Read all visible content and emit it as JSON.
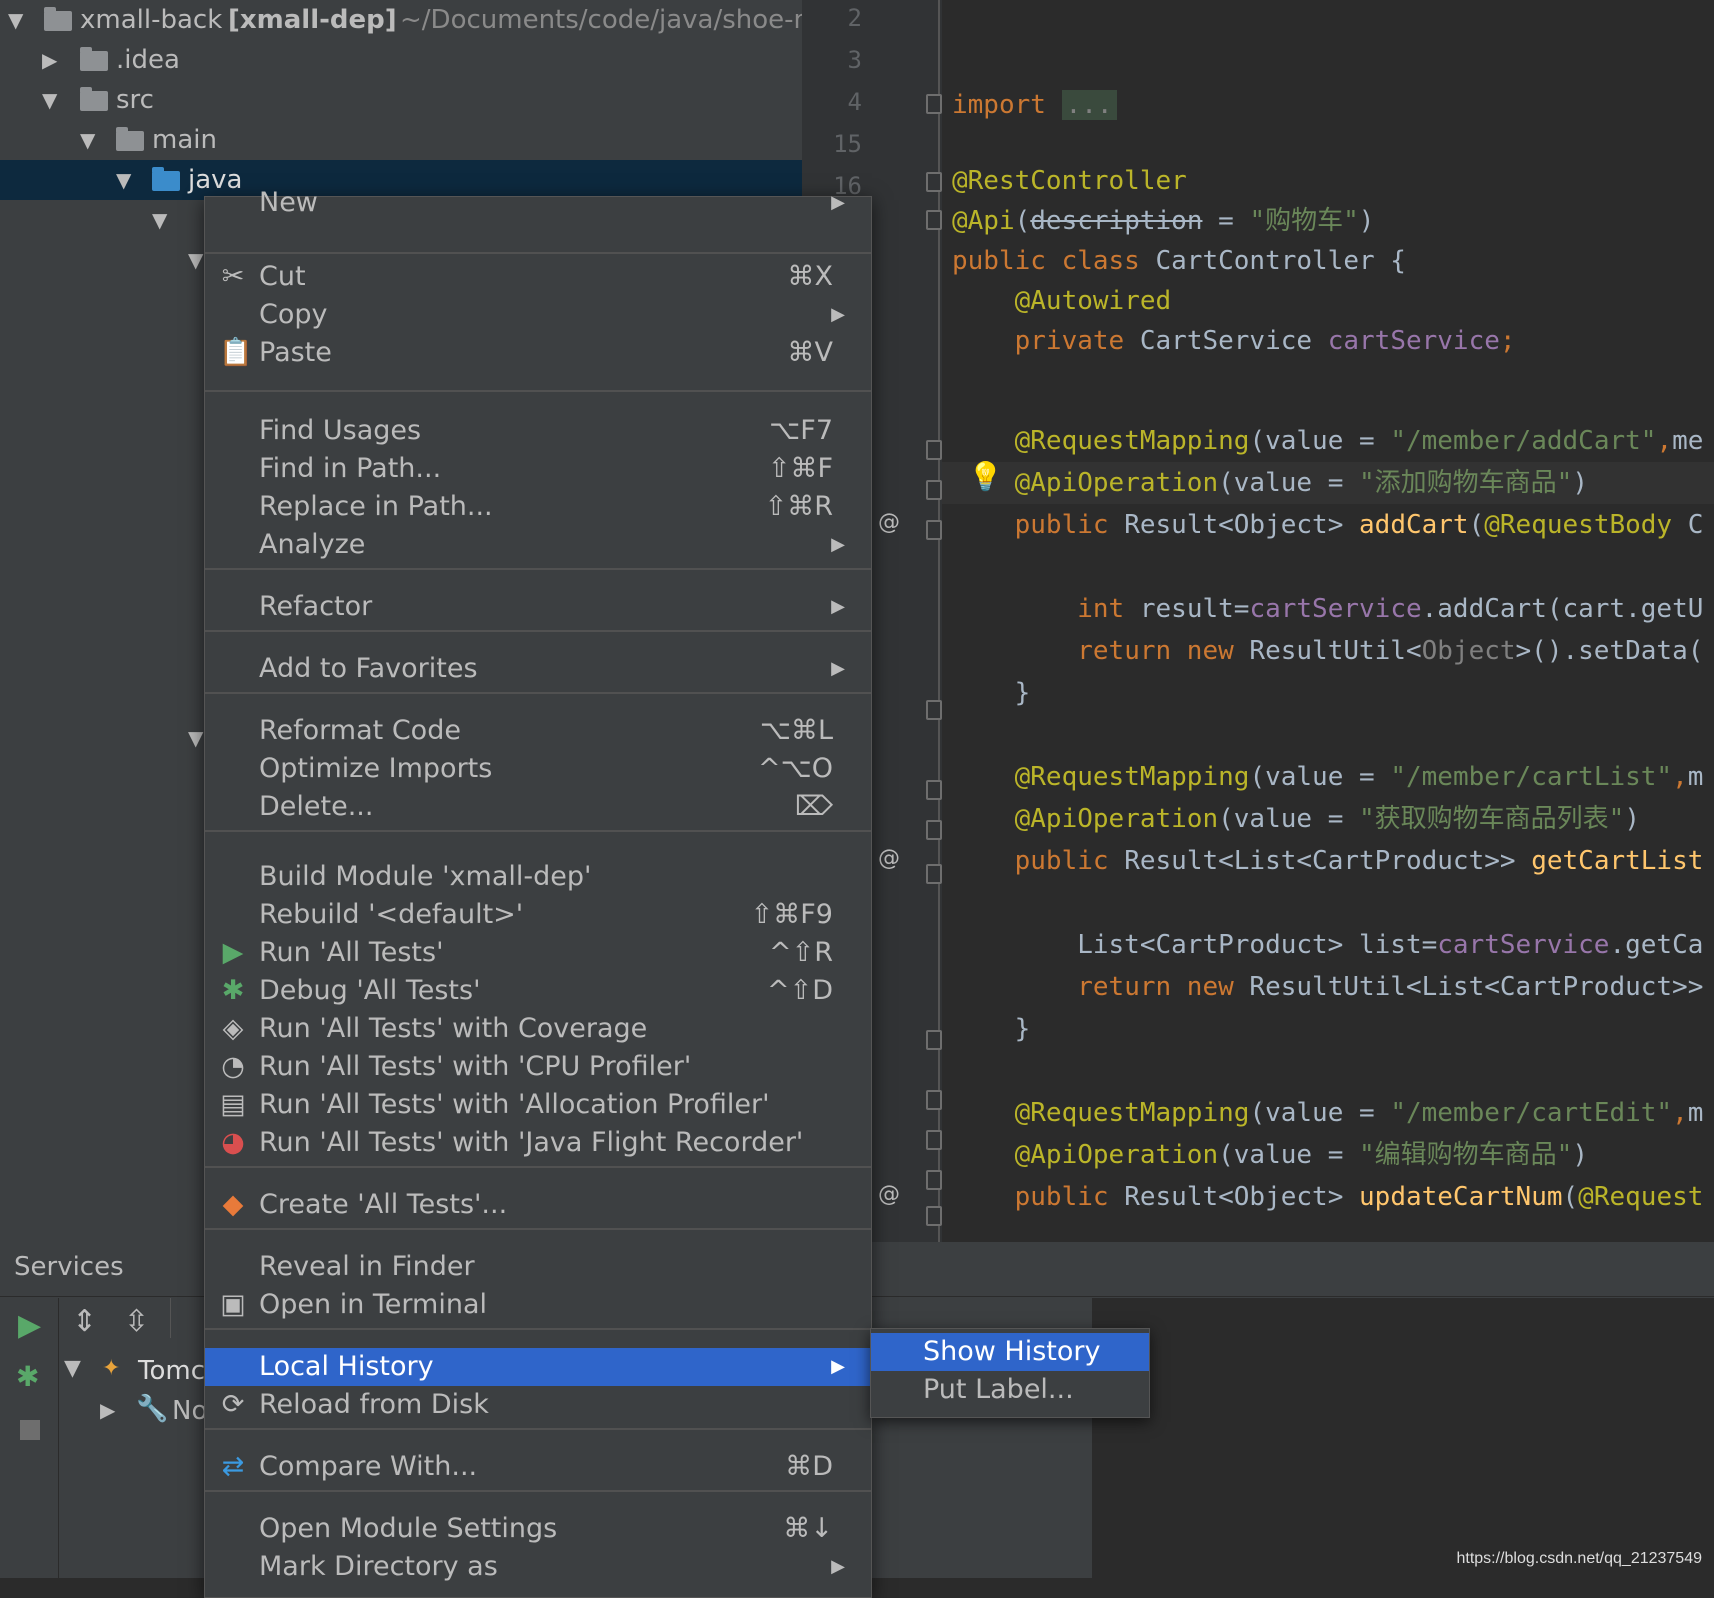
{
  "tree": {
    "root": {
      "name": "xmall-back",
      "module": "[xmall-dep]",
      "path": "~/Documents/code/java/shoe-m"
    },
    "items": [
      ".idea",
      "src",
      "main",
      "java"
    ]
  },
  "gutter": {
    "line_numbers": [
      "2",
      "3",
      "4",
      "15",
      "16"
    ]
  },
  "editor": {
    "lines": [
      {
        "parts": [
          [
            "kw",
            "import "
          ],
          [
            "gr",
            "..."
          ]
        ]
      },
      {
        "parts": [
          [
            "an",
            "@RestController"
          ]
        ]
      },
      {
        "parts": [
          [
            "an",
            "@Api"
          ],
          [
            "",
            "("
          ],
          [
            "",
            "description"
          ],
          [
            "",
            " = "
          ],
          [
            "st",
            "\"购物车\""
          ],
          [
            "",
            ")"
          ]
        ]
      },
      {
        "parts": [
          [
            "kw",
            "public class "
          ],
          [
            "",
            "CartController {"
          ]
        ]
      },
      {
        "parts": [
          [
            "",
            "    "
          ],
          [
            "an",
            "@Autowired"
          ]
        ]
      },
      {
        "parts": [
          [
            "",
            "    "
          ],
          [
            "kw",
            "private "
          ],
          [
            "",
            "CartService "
          ],
          [
            "fd",
            "cartService"
          ],
          [
            "kw",
            ";"
          ]
        ]
      },
      {
        "parts": []
      },
      {
        "parts": [
          [
            "",
            "    "
          ],
          [
            "an",
            "@RequestMapping"
          ],
          [
            "",
            "(value = "
          ],
          [
            "st",
            "\"/member/addCart\""
          ],
          [
            "kw",
            ","
          ],
          [
            "",
            "me"
          ]
        ]
      },
      {
        "parts": [
          [
            "",
            "    "
          ],
          [
            "an",
            "@ApiOperation"
          ],
          [
            "",
            "(value = "
          ],
          [
            "st",
            "\"添加购物车商品\""
          ],
          [
            "",
            ")"
          ]
        ]
      },
      {
        "parts": [
          [
            "",
            "    "
          ],
          [
            "kw",
            "public "
          ],
          [
            "",
            "Result<Object> "
          ],
          [
            "fn",
            "addCart"
          ],
          [
            "",
            "("
          ],
          [
            "an",
            "@RequestBody"
          ],
          [
            "",
            " C"
          ]
        ]
      },
      {
        "parts": []
      },
      {
        "parts": [
          [
            "",
            "        "
          ],
          [
            "kw",
            "int "
          ],
          [
            "",
            "result="
          ],
          [
            "fd",
            "cartService"
          ],
          [
            "",
            ".addCart(cart.getU"
          ]
        ]
      },
      {
        "parts": [
          [
            "",
            "        "
          ],
          [
            "kw",
            "return new "
          ],
          [
            "",
            "ResultUtil<"
          ],
          [
            "gr",
            "Object"
          ],
          [
            "",
            ">().setData("
          ]
        ]
      },
      {
        "parts": [
          [
            "",
            "    }"
          ]
        ]
      },
      {
        "parts": []
      },
      {
        "parts": [
          [
            "",
            "    "
          ],
          [
            "an",
            "@RequestMapping"
          ],
          [
            "",
            "(value = "
          ],
          [
            "st",
            "\"/member/cartList\""
          ],
          [
            "kw",
            ","
          ],
          [
            "",
            "m"
          ]
        ]
      },
      {
        "parts": [
          [
            "",
            "    "
          ],
          [
            "an",
            "@ApiOperation"
          ],
          [
            "",
            "(value = "
          ],
          [
            "st",
            "\"获取购物车商品列表\""
          ],
          [
            "",
            ")"
          ]
        ]
      },
      {
        "parts": [
          [
            "",
            "    "
          ],
          [
            "kw",
            "public "
          ],
          [
            "",
            "Result<List<CartProduct>> "
          ],
          [
            "fn",
            "getCartList"
          ]
        ]
      },
      {
        "parts": []
      },
      {
        "parts": [
          [
            "",
            "        List<CartProduct> list="
          ],
          [
            "fd",
            "cartService"
          ],
          [
            "",
            ".getCa"
          ]
        ]
      },
      {
        "parts": [
          [
            "",
            "        "
          ],
          [
            "kw",
            "return new "
          ],
          [
            "",
            "ResultUtil<List<CartProduct>>"
          ]
        ]
      },
      {
        "parts": [
          [
            "",
            "    }"
          ]
        ]
      },
      {
        "parts": []
      },
      {
        "parts": [
          [
            "",
            "    "
          ],
          [
            "an",
            "@RequestMapping"
          ],
          [
            "",
            "(value = "
          ],
          [
            "st",
            "\"/member/cartEdit\""
          ],
          [
            "kw",
            ","
          ],
          [
            "",
            "m"
          ]
        ]
      },
      {
        "parts": [
          [
            "",
            "    "
          ],
          [
            "an",
            "@ApiOperation"
          ],
          [
            "",
            "(value = "
          ],
          [
            "st",
            "\"编辑购物车商品\""
          ],
          [
            "",
            ")"
          ]
        ]
      },
      {
        "parts": [
          [
            "",
            "    "
          ],
          [
            "kw",
            "public "
          ],
          [
            "",
            "Result<Object> "
          ],
          [
            "fn",
            "updateCartNum"
          ],
          [
            "",
            "("
          ],
          [
            "an",
            "@Request"
          ]
        ]
      }
    ]
  },
  "services": {
    "title": "Services",
    "tree_items": [
      "Tomc",
      "No"
    ]
  },
  "menu": {
    "items": [
      {
        "label": "New",
        "shortcut": "",
        "submenu": true,
        "icon": ""
      },
      {
        "label": "Cut",
        "shortcut": "⌘X",
        "submenu": false,
        "icon": "scissors-icon"
      },
      {
        "label": "Copy",
        "shortcut": "",
        "submenu": true,
        "icon": ""
      },
      {
        "label": "Paste",
        "shortcut": "⌘V",
        "submenu": false,
        "icon": "clipboard-icon"
      },
      {
        "label": "Find Usages",
        "shortcut": "⌥F7",
        "submenu": false,
        "icon": ""
      },
      {
        "label": "Find in Path...",
        "shortcut": "⇧⌘F",
        "submenu": false,
        "icon": ""
      },
      {
        "label": "Replace in Path...",
        "shortcut": "⇧⌘R",
        "submenu": false,
        "icon": ""
      },
      {
        "label": "Analyze",
        "shortcut": "",
        "submenu": true,
        "icon": ""
      },
      {
        "label": "Refactor",
        "shortcut": "",
        "submenu": true,
        "icon": ""
      },
      {
        "label": "Add to Favorites",
        "shortcut": "",
        "submenu": true,
        "icon": ""
      },
      {
        "label": "Reformat Code",
        "shortcut": "⌥⌘L",
        "submenu": false,
        "icon": ""
      },
      {
        "label": "Optimize Imports",
        "shortcut": "^⌥O",
        "submenu": false,
        "icon": ""
      },
      {
        "label": "Delete...",
        "shortcut": "⌦",
        "submenu": false,
        "icon": ""
      },
      {
        "label": "Build Module 'xmall-dep'",
        "shortcut": "",
        "submenu": false,
        "icon": ""
      },
      {
        "label": "Rebuild '<default>'",
        "shortcut": "⇧⌘F9",
        "submenu": false,
        "icon": ""
      },
      {
        "label": "Run 'All Tests'",
        "shortcut": "^⇧R",
        "submenu": false,
        "icon": "run-icon"
      },
      {
        "label": "Debug 'All Tests'",
        "shortcut": "^⇧D",
        "submenu": false,
        "icon": "debug-icon"
      },
      {
        "label": "Run 'All Tests' with Coverage",
        "shortcut": "",
        "submenu": false,
        "icon": "coverage-icon"
      },
      {
        "label": "Run 'All Tests' with 'CPU Profiler'",
        "shortcut": "",
        "submenu": false,
        "icon": "cpu-profiler-icon"
      },
      {
        "label": "Run 'All Tests' with 'Allocation Profiler'",
        "shortcut": "",
        "submenu": false,
        "icon": "allocation-profiler-icon"
      },
      {
        "label": "Run 'All Tests' with 'Java Flight Recorder'",
        "shortcut": "",
        "submenu": false,
        "icon": "flight-recorder-icon"
      },
      {
        "label": "Create 'All Tests'...",
        "shortcut": "",
        "submenu": false,
        "icon": "create-test-icon"
      },
      {
        "label": "Reveal in Finder",
        "shortcut": "",
        "submenu": false,
        "icon": ""
      },
      {
        "label": "Open in Terminal",
        "shortcut": "",
        "submenu": false,
        "icon": "terminal-icon"
      },
      {
        "label": "Local History",
        "shortcut": "",
        "submenu": true,
        "icon": ""
      },
      {
        "label": "Reload from Disk",
        "shortcut": "",
        "submenu": false,
        "icon": "reload-icon"
      },
      {
        "label": "Compare With...",
        "shortcut": "⌘D",
        "submenu": false,
        "icon": "compare-icon"
      },
      {
        "label": "Open Module Settings",
        "shortcut": "⌘↓",
        "submenu": false,
        "icon": ""
      },
      {
        "label": "Mark Directory as",
        "shortcut": "",
        "submenu": true,
        "icon": ""
      }
    ],
    "highlighted": "Local History"
  },
  "submenu": {
    "items": [
      "Show History",
      "Put Label..."
    ],
    "highlighted": "Show History"
  },
  "watermark": "https://blog.csdn.net/qq_21237549",
  "colors": {
    "accent": "#2f65ca",
    "menu_bg": "#3c3f41",
    "editor_bg": "#2b2b2b"
  }
}
